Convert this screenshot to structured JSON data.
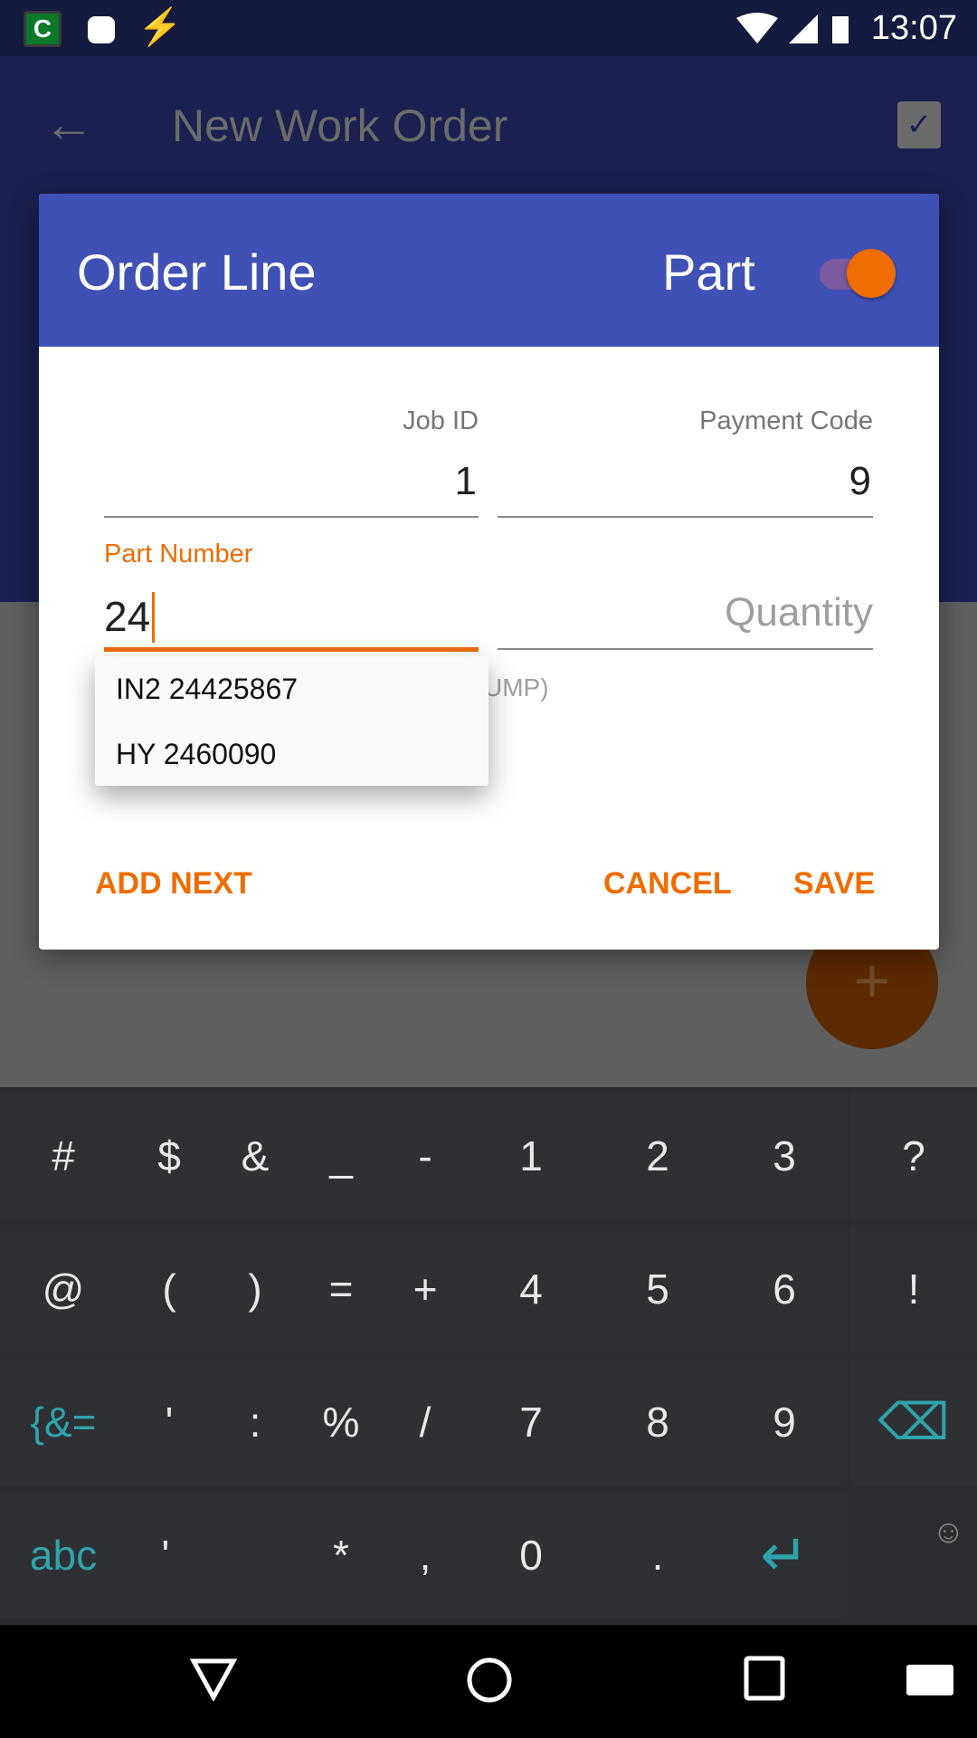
{
  "status_bar": {
    "time": "13:07",
    "icons": [
      "app-c-icon",
      "android-icon",
      "flash-icon",
      "wifi-icon",
      "signal-icon",
      "battery-charging-icon"
    ]
  },
  "app_bar": {
    "title": "New Work Order",
    "back_icon": "arrow-left-icon",
    "action_icon": "clipboard-check-icon"
  },
  "dialog": {
    "title": "Order Line",
    "toggle_label": "Part",
    "toggle_on": true,
    "fields": {
      "job_id": {
        "label": "Job ID",
        "value": "1"
      },
      "payment_code": {
        "label": "Payment Code",
        "value": "9"
      },
      "part_number": {
        "label": "Part Number",
        "value": "24"
      },
      "quantity": {
        "placeholder": "Quantity"
      }
    },
    "hidden_text": "UMP)",
    "suggestions": [
      "IN2 24425867",
      "HY 2460090"
    ],
    "buttons": {
      "add_next": "ADD NEXT",
      "cancel": "CANCEL",
      "save": "SAVE"
    }
  },
  "fab": {
    "label": "+"
  },
  "keyboard": {
    "rows": [
      [
        "#",
        "$",
        "&",
        "_",
        "-",
        "1",
        "2",
        "3",
        "?"
      ],
      [
        "@",
        "(",
        ")",
        "=",
        "+",
        "4",
        "5",
        "6",
        "!"
      ],
      [
        "{&=",
        "'",
        ":",
        "%",
        "/",
        "7",
        "8",
        "9",
        "⌫"
      ],
      [
        "abc",
        "\"",
        "",
        "*",
        ",",
        "0",
        ".",
        "↵"
      ]
    ]
  },
  "colors": {
    "accent": "#ef6c00",
    "primary": "#3f51b5",
    "keyboard_accent": "#2fa3ab"
  }
}
